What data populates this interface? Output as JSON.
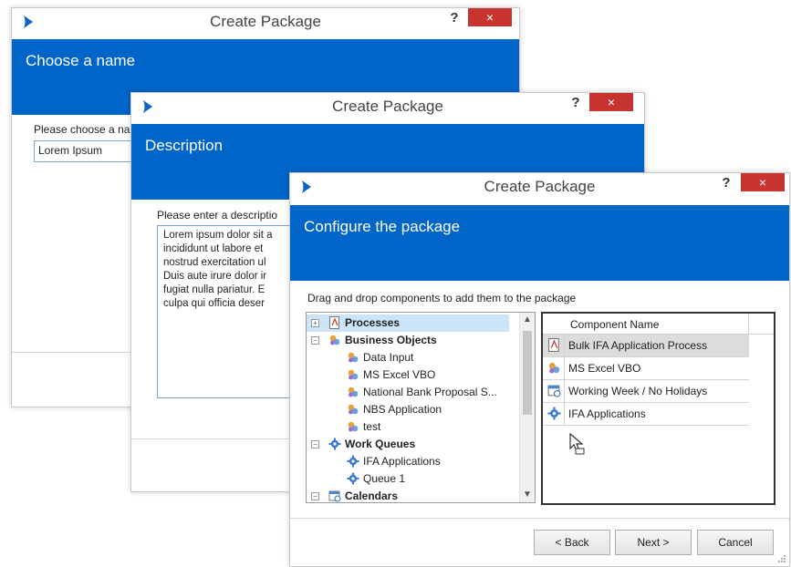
{
  "window1": {
    "title": "Create Package",
    "help": "?",
    "close": "×",
    "banner": "Choose a name",
    "prompt": "Please choose a na",
    "name_value": "Lorem Ipsum"
  },
  "window2": {
    "title": "Create Package",
    "help": "?",
    "close": "×",
    "banner": "Description",
    "prompt": "Please enter a descriptio",
    "description_lines": [
      "Lorem ipsum dolor sit a",
      "incididunt ut labore et",
      "nostrud exercitation ul",
      "Duis aute irure dolor ir",
      "fugiat nulla pariatur. E",
      "culpa qui officia deser"
    ]
  },
  "window3": {
    "title": "Create Package",
    "help": "?",
    "close": "×",
    "banner": "Configure the package",
    "instructions": "Drag and drop components to add them to the package",
    "tree": [
      {
        "label": "Processes",
        "icon": "process-icon",
        "level": 0,
        "bold": true,
        "selected": true,
        "expander": "+"
      },
      {
        "label": "Business Objects",
        "icon": "business-object-icon",
        "level": 0,
        "bold": true,
        "selected": false,
        "expander": "−"
      },
      {
        "label": "Data Input",
        "icon": "business-object-icon",
        "level": 1,
        "bold": false,
        "selected": false
      },
      {
        "label": "MS Excel VBO",
        "icon": "business-object-icon",
        "level": 1,
        "bold": false,
        "selected": false
      },
      {
        "label": "National Bank Proposal S...",
        "icon": "business-object-icon",
        "level": 1,
        "bold": false,
        "selected": false
      },
      {
        "label": "NBS Application",
        "icon": "business-object-icon",
        "level": 1,
        "bold": false,
        "selected": false
      },
      {
        "label": "test",
        "icon": "business-object-icon",
        "level": 1,
        "bold": false,
        "selected": false
      },
      {
        "label": "Work Queues",
        "icon": "gear-icon",
        "level": 0,
        "bold": true,
        "selected": false,
        "expander": "−"
      },
      {
        "label": "IFA Applications",
        "icon": "gear-icon",
        "level": 1,
        "bold": false,
        "selected": false
      },
      {
        "label": "Queue 1",
        "icon": "gear-icon",
        "level": 1,
        "bold": false,
        "selected": false
      },
      {
        "label": "Calendars",
        "icon": "calendar-icon",
        "level": 0,
        "bold": true,
        "selected": false,
        "expander": "−"
      }
    ],
    "grid_header": "Component Name",
    "grid_rows": [
      {
        "label": "Bulk IFA Application Process",
        "icon": "process-icon",
        "selected": true
      },
      {
        "label": "MS Excel VBO",
        "icon": "business-object-icon",
        "selected": false
      },
      {
        "label": "Working Week / No Holidays",
        "icon": "calendar-icon",
        "selected": false
      },
      {
        "label": "IFA Applications",
        "icon": "gear-icon",
        "selected": false
      }
    ],
    "buttons": {
      "back": "< Back",
      "next": "Next >",
      "cancel": "Cancel"
    }
  },
  "colors": {
    "banner": "#0065c8",
    "close": "#c7342f",
    "selection": "#cce4f7"
  }
}
